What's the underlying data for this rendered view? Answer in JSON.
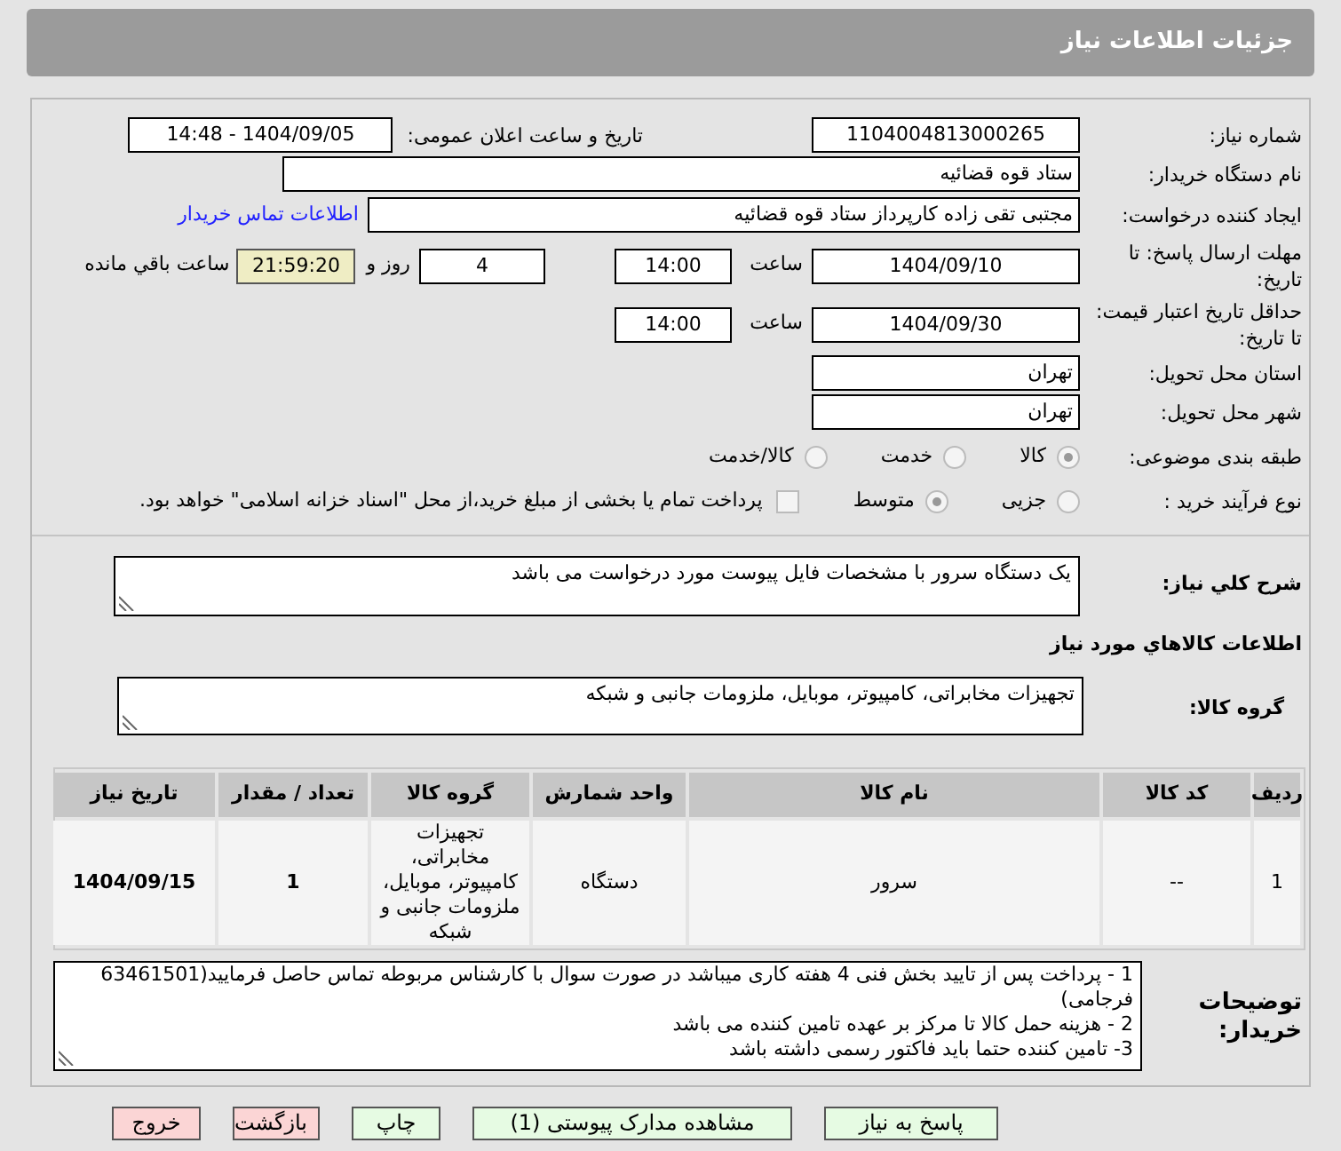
{
  "page_title": "جزئیات اطلاعات نیاز",
  "need_number": {
    "label": "شماره نیاز:",
    "value": "1104004813000265"
  },
  "announce_datetime": {
    "label": "تاریخ و ساعت اعلان عمومی:",
    "value": "1404/09/05 - 14:48"
  },
  "buyer_org": {
    "label": "نام دستگاه خریدار:",
    "value": "ستاد قوه قضائیه"
  },
  "requester": {
    "label": "ایجاد کننده درخواست:",
    "value": "مجتبی تقی زاده کارپرداز ستاد قوه قضائیه",
    "link": "اطلاعات تماس خریدار"
  },
  "reply_deadline": {
    "label": "مهلت ارسال پاسخ: تا تاریخ:",
    "date": "1404/09/10",
    "time_label": "ساعت",
    "time": "14:00",
    "days": "4",
    "days_label": "روز و",
    "remaining": "21:59:20",
    "remaining_label": "ساعت باقي مانده"
  },
  "price_validity": {
    "label": "حداقل تاریخ اعتبار قیمت: تا تاریخ:",
    "date": "1404/09/30",
    "time_label": "ساعت",
    "time": "14:00"
  },
  "province": {
    "label": "استان محل تحویل:",
    "value": "تهران"
  },
  "city": {
    "label": "شهر محل تحویل:",
    "value": "تهران"
  },
  "category": {
    "label": "طبقه بندی موضوعی:",
    "options": [
      {
        "label": "کالا",
        "selected": true
      },
      {
        "label": "خدمت",
        "selected": false
      },
      {
        "label": "کالا/خدمت",
        "selected": false
      }
    ]
  },
  "purchase_process": {
    "label": "نوع فرآیند خرید :",
    "options": [
      {
        "label": "جزیی",
        "selected": false
      },
      {
        "label": "متوسط",
        "selected": true
      }
    ],
    "payment_note": {
      "checked": false,
      "text": "پرداخت تمام یا بخشی از مبلغ خرید،از محل \"اسناد خزانه اسلامی\" خواهد بود."
    }
  },
  "description": {
    "label": "شرح کلي نياز:",
    "value": "یک دستگاه سرور با مشخصات فایل پیوست مورد درخواست می باشد"
  },
  "goods_section_title": "اطلاعات کالاهاي مورد نياز",
  "goods_group": {
    "label": "گروه کالا:",
    "value": "تجهیزات مخابراتی، کامپیوتر، موبایل، ملزومات جانبی و شبکه"
  },
  "table": {
    "columns": [
      "ردیف",
      "کد کالا",
      "نام کالا",
      "واحد شمارش",
      "گروه کالا",
      "تعداد / مقدار",
      "تاریخ نیاز"
    ],
    "rows": [
      [
        "1",
        "--",
        "سرور",
        "دستگاه",
        "تجهیزات مخابراتی، کامپیوتر، موبایل، ملزومات جانبی و شبکه",
        "1",
        "1404/09/15"
      ]
    ]
  },
  "buyer_notes": {
    "label": "توضیحات خریدار:",
    "lines": [
      "1 - پرداخت پس از تایید بخش فنی 4 هفته کاری میباشد در صورت سوال با کارشناس مربوطه تماس حاصل فرمایید(63461501 فرجامی)",
      "2 - هزینه حمل کالا تا مرکز بر عهده تامین کننده می باشد",
      "3- تامین کننده حتما باید فاکتور رسمی داشته باشد"
    ]
  },
  "buttons": [
    {
      "label": "پاسخ به نیاز",
      "kind": "action"
    },
    {
      "label": "مشاهده مدارک پیوستی (1)",
      "kind": "action"
    },
    {
      "label": "چاپ",
      "kind": "action"
    },
    {
      "label": "بازگشت",
      "kind": "exit"
    },
    {
      "label": "خروج",
      "kind": "exit"
    }
  ]
}
